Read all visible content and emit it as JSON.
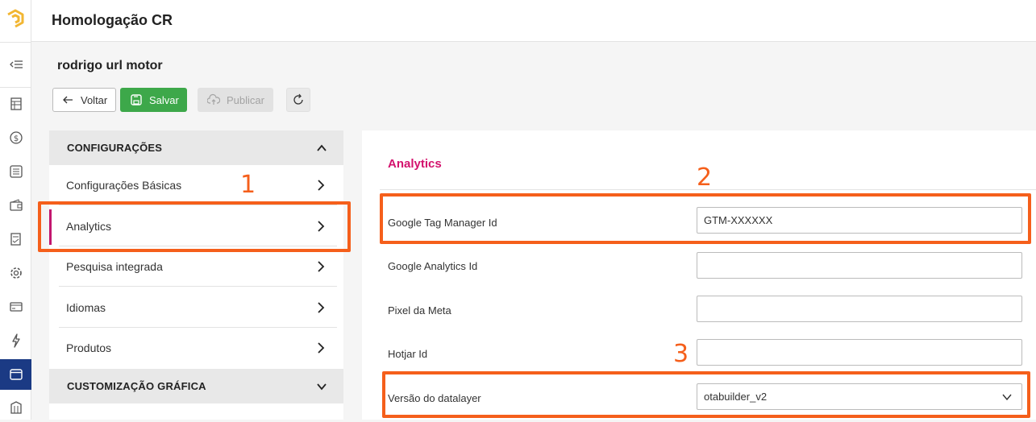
{
  "app": {
    "title": "Homologação CR"
  },
  "rail": {
    "logo_icon": "brand-logo",
    "collapse_icon": "collapse-menu-icon",
    "items": [
      {
        "icon": "spreadsheet-icon",
        "active": false
      },
      {
        "icon": "dollar-icon",
        "active": false
      },
      {
        "icon": "list-icon",
        "active": false
      },
      {
        "icon": "wallet-icon",
        "active": false
      },
      {
        "icon": "checklist-icon",
        "active": false
      },
      {
        "icon": "gear-icon",
        "active": false
      },
      {
        "icon": "card-icon",
        "active": false
      },
      {
        "icon": "lightning-icon",
        "active": false
      },
      {
        "icon": "browser-window-icon",
        "active": true
      },
      {
        "icon": "building-icon",
        "active": false
      }
    ]
  },
  "page": {
    "title": "rodrigo url motor"
  },
  "toolbar": {
    "back_label": "Voltar",
    "save_label": "Salvar",
    "publish_label": "Publicar",
    "refresh_icon": "refresh-icon"
  },
  "menu": {
    "section1": "CONFIGURAÇÕES",
    "items": [
      {
        "label": "Configurações Básicas",
        "active": false
      },
      {
        "label": "Analytics",
        "active": true
      },
      {
        "label": "Pesquisa integrada",
        "active": false
      },
      {
        "label": "Idiomas",
        "active": false
      },
      {
        "label": "Produtos",
        "active": false
      }
    ],
    "section2": "CUSTOMIZAÇÃO GRÁFICA"
  },
  "analytics": {
    "title": "Analytics",
    "fields": [
      {
        "label": "Google Tag Manager Id",
        "value": "GTM-XXXXXX"
      },
      {
        "label": "Google Analytics Id",
        "value": ""
      },
      {
        "label": "Pixel da Meta",
        "value": ""
      },
      {
        "label": "Hotjar Id",
        "value": ""
      },
      {
        "label": "Versão do datalayer",
        "value": "otabuilder_v2"
      }
    ]
  },
  "annotations": {
    "n1": "1",
    "n2": "2",
    "n3": "3",
    "color": "#f55f1b"
  },
  "colors": {
    "accent": "#d3126d",
    "save": "#3da84a",
    "active_nav": "#1b3a84"
  }
}
